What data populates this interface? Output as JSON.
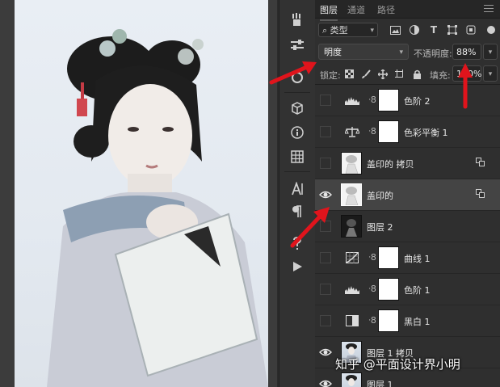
{
  "panel": {
    "tabs": [
      {
        "label": "图层",
        "active": true
      },
      {
        "label": "通道",
        "active": false
      },
      {
        "label": "路径",
        "active": false
      }
    ],
    "filter": {
      "label": "类型",
      "icon": "search-icon"
    },
    "filter_icons": [
      "image-filter-icon",
      "adjustment-filter-icon",
      "type-filter-icon",
      "shape-filter-icon",
      "smart-object-filter-icon"
    ],
    "blend_mode": "明度",
    "opacity_label": "不透明度:",
    "opacity_value": "88%",
    "lock_label": "锁定:",
    "lock_icons": [
      "lock-transparent-icon",
      "lock-paint-icon",
      "lock-position-icon",
      "lock-artboard-icon",
      "lock-all-icon"
    ],
    "fill_label": "填充:",
    "fill_value": "100%"
  },
  "layers": [
    {
      "name": "色阶 2",
      "kind": "adjustment",
      "icon": "levels-icon",
      "visible": false,
      "selected": false
    },
    {
      "name": "色彩平衡 1",
      "kind": "adjustment",
      "icon": "color-balance-icon",
      "visible": false,
      "selected": false
    },
    {
      "name": "盖印的 拷贝",
      "kind": "smart",
      "visible": false,
      "selected": false
    },
    {
      "name": "盖印的",
      "kind": "smart",
      "visible": true,
      "selected": true
    },
    {
      "name": "图层 2",
      "kind": "pixel-dark",
      "visible": false,
      "selected": false
    },
    {
      "name": "曲线 1",
      "kind": "adjustment",
      "icon": "curves-icon",
      "visible": false,
      "selected": false
    },
    {
      "name": "色阶 1",
      "kind": "adjustment",
      "icon": "levels-icon",
      "visible": false,
      "selected": false
    },
    {
      "name": "黑白 1",
      "kind": "adjustment",
      "icon": "black-white-icon",
      "visible": false,
      "selected": false
    },
    {
      "name": "图层 1 拷贝",
      "kind": "pixel-photo",
      "visible": true,
      "selected": false
    },
    {
      "name": "图层 1",
      "kind": "pixel-photo",
      "visible": true,
      "selected": false
    }
  ],
  "tools": [
    "brush-history-icon",
    "adjust-sliders-icon",
    "info-circle-icon",
    "3d-cube-icon",
    "info-icon",
    "grid-icon",
    "character-icon",
    "paragraph-icon",
    "glyphs-icon",
    "play-icon"
  ],
  "colors": {
    "panel_bg": "#2f2f2f",
    "selected_layer": "#444444",
    "annotation_red": "#e0141c"
  },
  "watermark": "知乎 @平面设计界小明"
}
